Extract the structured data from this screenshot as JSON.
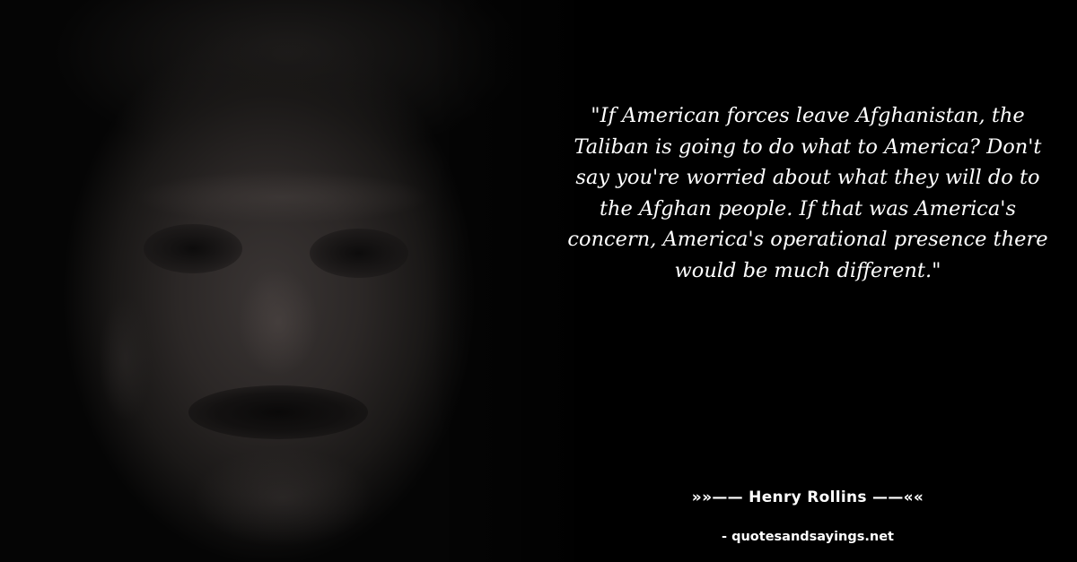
{
  "quote": {
    "text": "\"If American forces leave Afghanistan, the Taliban is going to do what to America? Don't say you're worried about what they will do to the Afghan people. If that was America's concern, America's operational presence there would be much different.\"",
    "author_line": "»»—— Henry Rollins ——««",
    "source": "- quotesandsayings.net"
  },
  "colors": {
    "background": "#000000",
    "text": "#ffffff"
  }
}
